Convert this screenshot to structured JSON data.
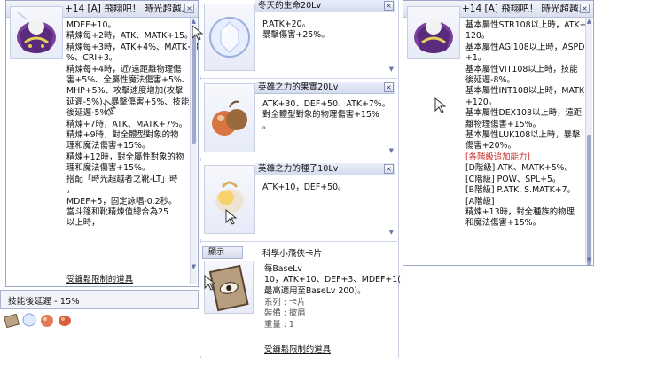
{
  "left_window": {
    "title": "+14 [A] 飛翔吧！ 時光超越...",
    "lines": [
      "MDEF+10。",
      "精煉每+2時，ATK、MATK+15。",
      "精煉每+3時，ATK+4%、MATK+4",
      "%、CRI+3。",
      "精煉每+4時，近/遠距離物理傷",
      "害+5%、全屬性魔法傷害+5%、",
      "MHP+5%、攻擊速度增加(攻擊",
      "延遲-5%)、暴擊傷害+5%、技能",
      "後延遲-5%。",
      "精煉+7時，ATK、MATK+7%。",
      "精煉+9時，對全體型對象的物",
      "理和魔法傷害+15%。",
      "精煉+12時，對全屬性對象的物",
      "理和魔法傷害+15%。",
      "搭配「時光超越者之靴-LT」時",
      "，",
      "MDEF+5，固定詠唱-0.2秒。",
      "當斗篷和靴精煉值總合為25",
      "以上時，"
    ],
    "link": "受鐮鬆限制的道具"
  },
  "status_bar": {
    "text": "技能後延遲 - 15%"
  },
  "right_window": {
    "title": "+14 [A] 飛翔吧！ 時光超越...",
    "lines": [
      "基本屬性STR108以上時，ATK+",
      "120。",
      "基本屬性AGI108以上時，ASPD",
      "+1。",
      "基本屬性VIT108以上時，技能",
      "後延遲-8%。",
      "基本屬性INT108以上時，MATK",
      "+120。",
      "基本屬性DEX108以上時，遠距",
      "離物理傷害+15%。",
      "基本屬性LUK108以上時，暴擊",
      "傷害+20%。"
    ],
    "red_line": "[各階級追加能力]",
    "grade_lines": [
      "[D階級] ATK、MATK+5%。",
      "[C階級] POW、SPL+5。",
      "[B階級] P.ATK, S.MATK+7。",
      "[A階級]",
      " 精煉+13時，對全種族的物理",
      "和魔法傷害+15%。"
    ]
  },
  "cards": [
    {
      "title": "冬天的生命20Lv",
      "lines": [
        "P.ATK+20。",
        "暴擊傷害+25%。"
      ]
    },
    {
      "title": "英雄之力的果實20Lv",
      "lines": [
        "ATK+30、DEF+50、ATK+7%。",
        "對全體型對象的物理傷害+15%",
        "。"
      ]
    },
    {
      "title": "英雄之力的種子10Lv",
      "lines": [
        "ATK+10，DEF+50。"
      ]
    }
  ],
  "card_window": {
    "tab": "顯示",
    "title": "科學小飛俠卡片",
    "lines": [
      "每BaseLv",
      "10，ATK+10、DEF+3、MDEF+1(",
      "最高適用至BaseLv 200)。"
    ],
    "type_label": "系列 : 卡片",
    "equip_label": "裝備 : 披肩",
    "weight_label": "重量 : 1",
    "link": "受鐮鬆限制的道具"
  },
  "colors": {
    "window_border": "#9aa7c8",
    "title_bg": "#dde3f2",
    "red_text": "#cc2a2a",
    "scroll_thumb": "#9fa9c9"
  },
  "icons": [
    "cloak-item-icon",
    "snow-crystal-icon",
    "fruit-icon",
    "seed-icon",
    "eye-card-icon",
    "cursor-arrow-icon"
  ]
}
